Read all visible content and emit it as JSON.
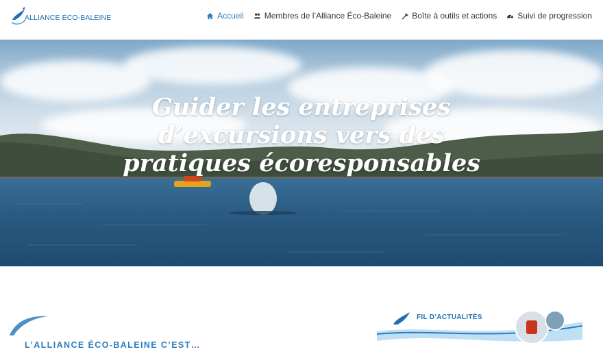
{
  "brand": {
    "name": "ALLIANCE ÉCO-BALEINE"
  },
  "nav": {
    "items": [
      {
        "label": "Accueil",
        "icon": "home-icon",
        "active": true
      },
      {
        "label": "Membres de l’Alliance Éco-Baleine",
        "icon": "members-icon",
        "active": false
      },
      {
        "label": "Boîte à outils et actions",
        "icon": "wrench-icon",
        "active": false
      },
      {
        "label": "Suivi de progression",
        "icon": "dashboard-icon",
        "active": false
      }
    ]
  },
  "hero": {
    "title": "Guider les entreprises d’excursions vers des pratiques écoresponsables"
  },
  "section": {
    "heading": "L’ALLIANCE ÉCO-BALEINE C’EST…"
  },
  "news": {
    "label": "FIL D’ACTUALITÉS"
  },
  "colors": {
    "accent": "#2b7cc0",
    "brand": "#1f6fb5"
  }
}
